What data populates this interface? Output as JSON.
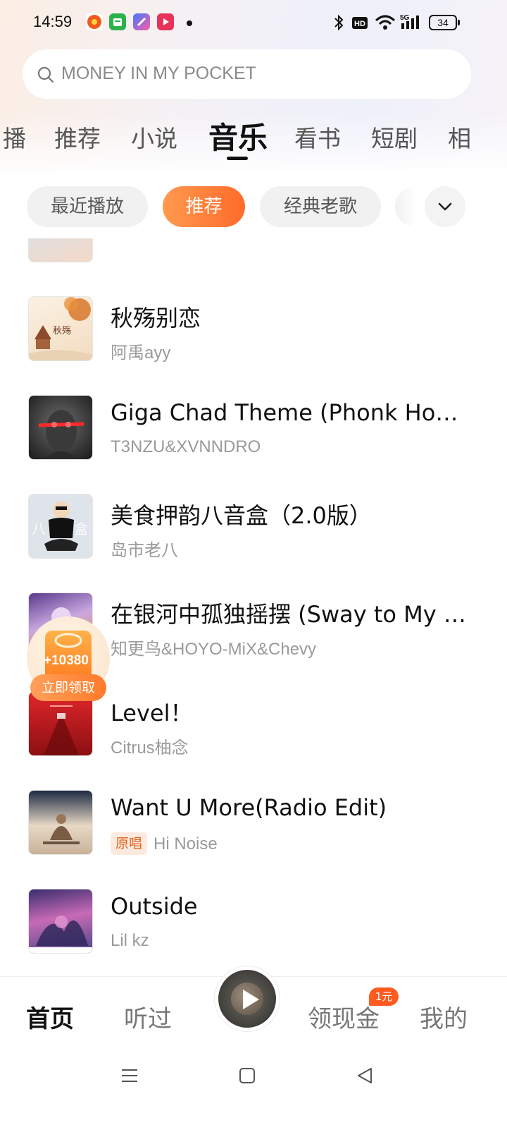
{
  "status_bar": {
    "time": "14:59",
    "battery": "34",
    "network": "5G"
  },
  "search": {
    "placeholder": "MONEY IN MY POCKET"
  },
  "category_tabs": [
    "播",
    "推荐",
    "小说",
    "音乐",
    "看书",
    "短剧",
    "相"
  ],
  "active_category": "音乐",
  "filter_chips": [
    "最近播放",
    "推荐",
    "经典老歌"
  ],
  "active_chip": "推荐",
  "songs": [
    {
      "title": "",
      "artist": "",
      "badge": ""
    },
    {
      "title": "秋殇别恋",
      "artist": "阿禹ayy",
      "badge": ""
    },
    {
      "title": "Giga Chad Theme (Phonk House Version)",
      "artist": "T3NZU&XVNNDRO",
      "badge": ""
    },
    {
      "title": "美食押韵八音盒（2.0版）",
      "artist": "岛市老八",
      "badge": ""
    },
    {
      "title": "在银河中孤独摇摆 (Sway to My Beat in Cosmos)",
      "artist": "知更鸟&HOYO-MiX&Chevy",
      "badge": ""
    },
    {
      "title": "Level！",
      "artist": "Citrus柚念",
      "badge": ""
    },
    {
      "title": "Want U More(Radio Edit)",
      "artist": "Hi Noise",
      "badge": "原唱"
    },
    {
      "title": "Outside",
      "artist": "Lil kz",
      "badge": ""
    }
  ],
  "reward": {
    "amount": "+10380",
    "button_label": "立即领取"
  },
  "bottom_nav": {
    "home": "首页",
    "history": "听过",
    "cash": "领现金",
    "cash_badge": "1元",
    "me": "我的"
  },
  "colors": {
    "accent": "#ff6b2b",
    "badge_text": "#e0641e"
  }
}
